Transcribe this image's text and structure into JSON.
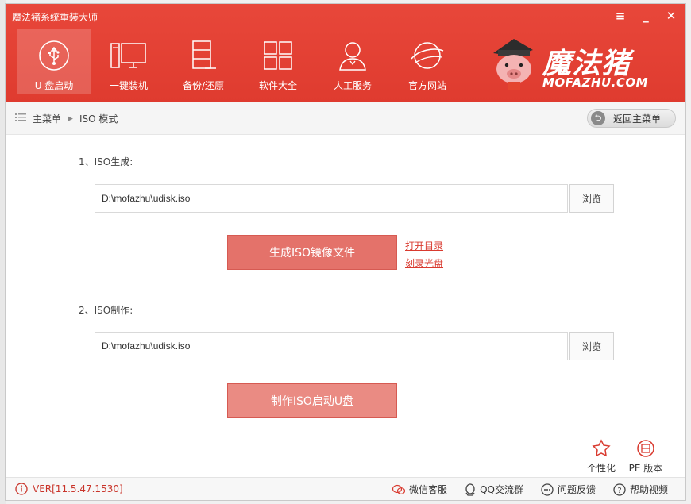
{
  "app": {
    "title": "魔法猪系统重装大师"
  },
  "window_controls": {
    "menu": "≡",
    "minimize": "_",
    "close": "✕"
  },
  "nav": [
    {
      "label": "U 盘启动",
      "icon": "usb-icon",
      "active": true
    },
    {
      "label": "一键装机",
      "icon": "computer-icon",
      "active": false
    },
    {
      "label": "备份/还原",
      "icon": "backup-icon",
      "active": false
    },
    {
      "label": "软件大全",
      "icon": "apps-grid-icon",
      "active": false
    },
    {
      "label": "人工服务",
      "icon": "support-person-icon",
      "active": false
    },
    {
      "label": "官方网站",
      "icon": "globe-icon",
      "active": false
    }
  ],
  "logo": {
    "brand": "魔法猪",
    "sub": "MOFAZHU.COM"
  },
  "breadcrumb": {
    "home": "主菜单",
    "current": "ISO 模式"
  },
  "back_button": {
    "label": "返回主菜单"
  },
  "section1": {
    "label": "1、ISO生成:",
    "path": "D:\\mofazhu\\udisk.iso",
    "browse": "浏览",
    "action": "生成ISO镜像文件",
    "open_dir": "打开目录",
    "burn_disc": "刻录光盘"
  },
  "section2": {
    "label": "2、ISO制作:",
    "path": "D:\\mofazhu\\udisk.iso",
    "browse": "浏览",
    "action": "制作ISO启动U盘"
  },
  "tools": {
    "personalize": "个性化",
    "pe_version": "PE 版本"
  },
  "footer": {
    "version": "VER[11.5.47.1530]",
    "wechat": "微信客服",
    "qq": "QQ交流群",
    "feedback": "问题反馈",
    "help": "帮助视频"
  },
  "colors": {
    "accent": "#e2453a",
    "button": "#e4726a"
  }
}
